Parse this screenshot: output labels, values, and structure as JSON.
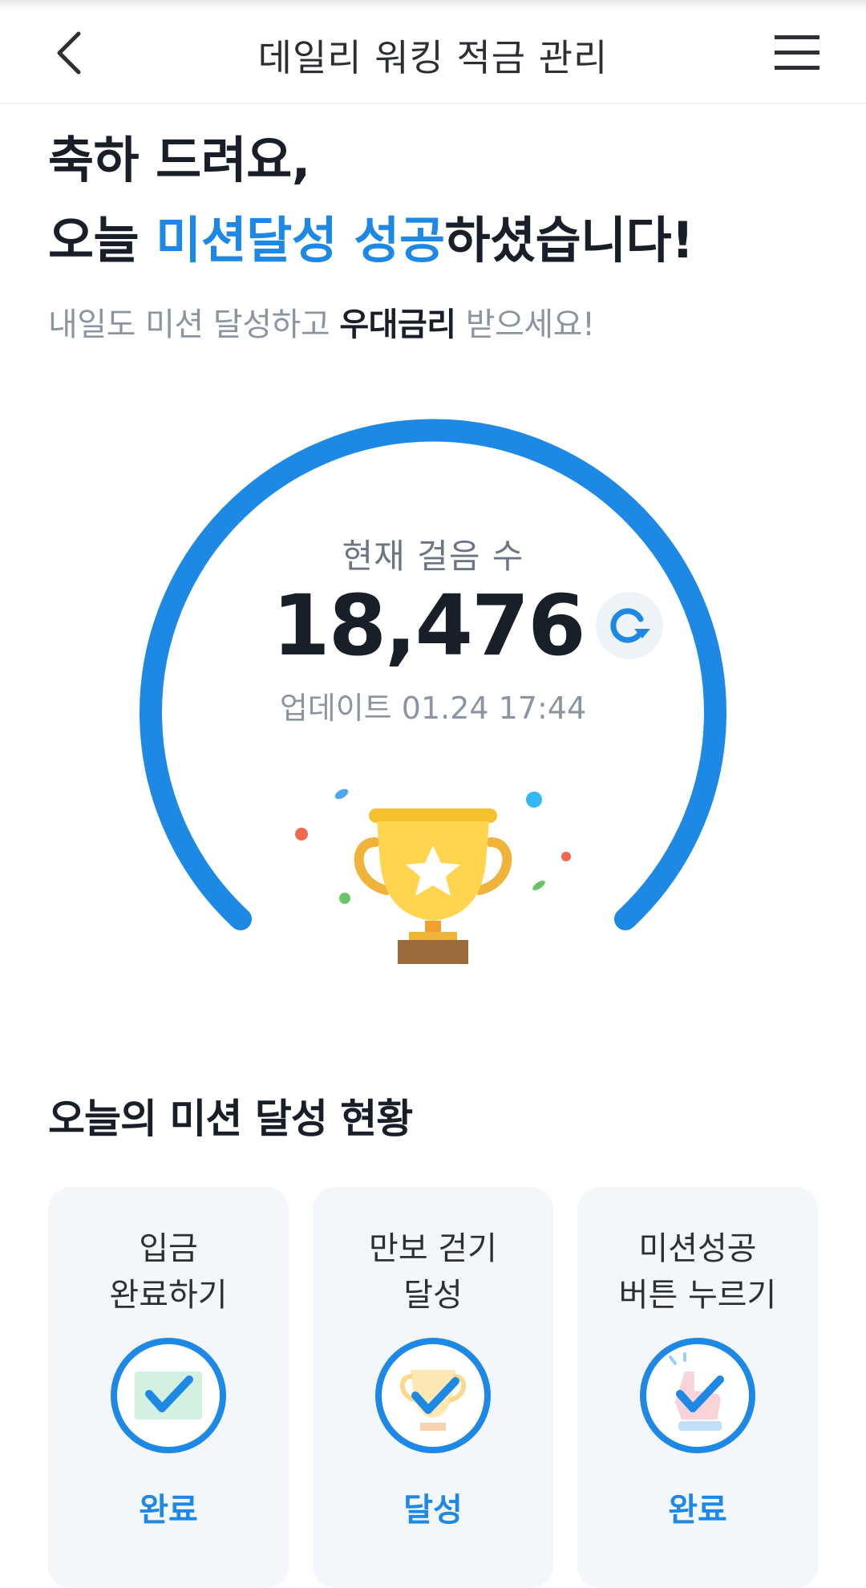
{
  "header": {
    "title": "데일리 워킹 적금 관리",
    "back_icon": "chevron-left-icon",
    "menu_icon": "hamburger-menu-icon"
  },
  "hero": {
    "line1": "축하 드려요,",
    "line2_prefix": "오늘 ",
    "line2_accent": "미션달성 성공",
    "line2_suffix": "하셨습니다!",
    "sub_prefix": "내일도 미션 달성하고 ",
    "sub_bold": "우대금리",
    "sub_suffix": " 받으세요!"
  },
  "steps": {
    "label": "현재 걸음 수",
    "value": "18,476",
    "update_label": "업데이트",
    "update_time": "01.24 17:44",
    "refresh_icon": "refresh-icon",
    "trophy_icon": "trophy-icon"
  },
  "missions": {
    "title": "오늘의 미션 달성 현황",
    "items": [
      {
        "line1": "입금",
        "line2": "완료하기",
        "status": "완료",
        "icon": "deposit-check-icon"
      },
      {
        "line1": "만보 걷기",
        "line2": "달성",
        "status": "달성",
        "icon": "trophy-check-icon"
      },
      {
        "line1": "미션성공",
        "line2": "버튼 누르기",
        "status": "완료",
        "icon": "tap-check-icon"
      }
    ]
  },
  "colors": {
    "accent": "#1e88e5",
    "text": "#191f28",
    "muted": "#8b95a1",
    "card_bg": "#f3f6fa"
  }
}
